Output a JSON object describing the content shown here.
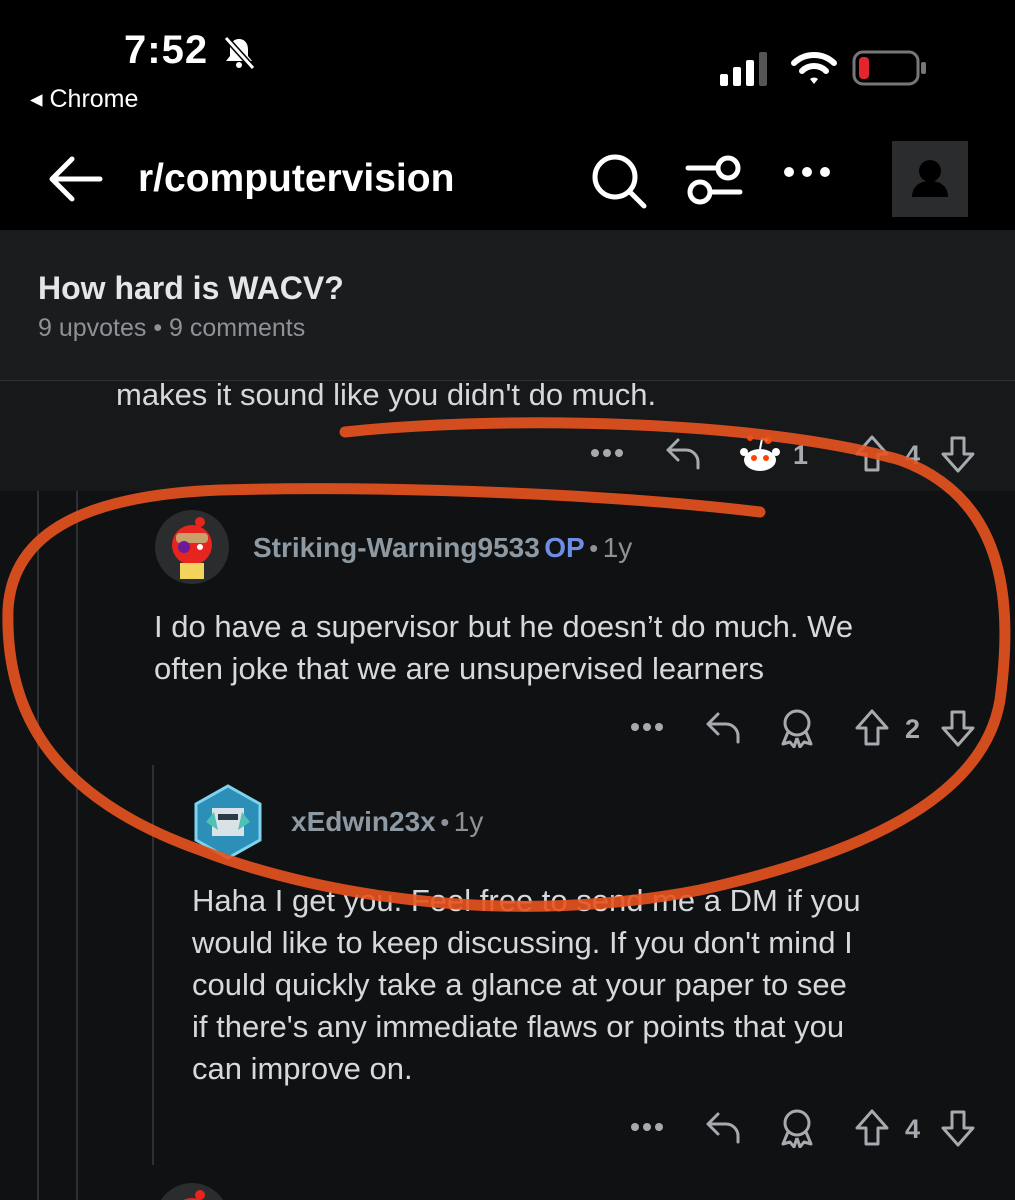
{
  "status_bar": {
    "time": "7:52",
    "back_app": "◂ Chrome",
    "battery_color": "#e4262c"
  },
  "header": {
    "subreddit": "r/computervision"
  },
  "post": {
    "title": "How hard is WACV?",
    "meta": "9 upvotes • 9 comments"
  },
  "comments": [
    {
      "text": "makes it sound like you didn't do much.",
      "award_count": "1",
      "votes": "4"
    },
    {
      "username": "Striking-Warning9533",
      "op_badge": "OP",
      "separator": "•",
      "age": "1y",
      "text_line1": "I do have a supervisor but he doesn’t do much. We",
      "text_line2": "often joke that we are unsupervised learners",
      "votes": "2"
    },
    {
      "username": "xEdwin23x",
      "separator": "•",
      "age": "1y",
      "text_line1": "Haha I get you. Feel free to send me a DM if you",
      "text_line2": "would like to keep discussing. If you don't mind I",
      "text_line3": "could quickly take a glance at your paper to see",
      "text_line4": "if there's any immediate flaws or points that you",
      "text_line5": "can improve on.",
      "votes": "4"
    }
  ],
  "annotation_color": "#e8531f"
}
